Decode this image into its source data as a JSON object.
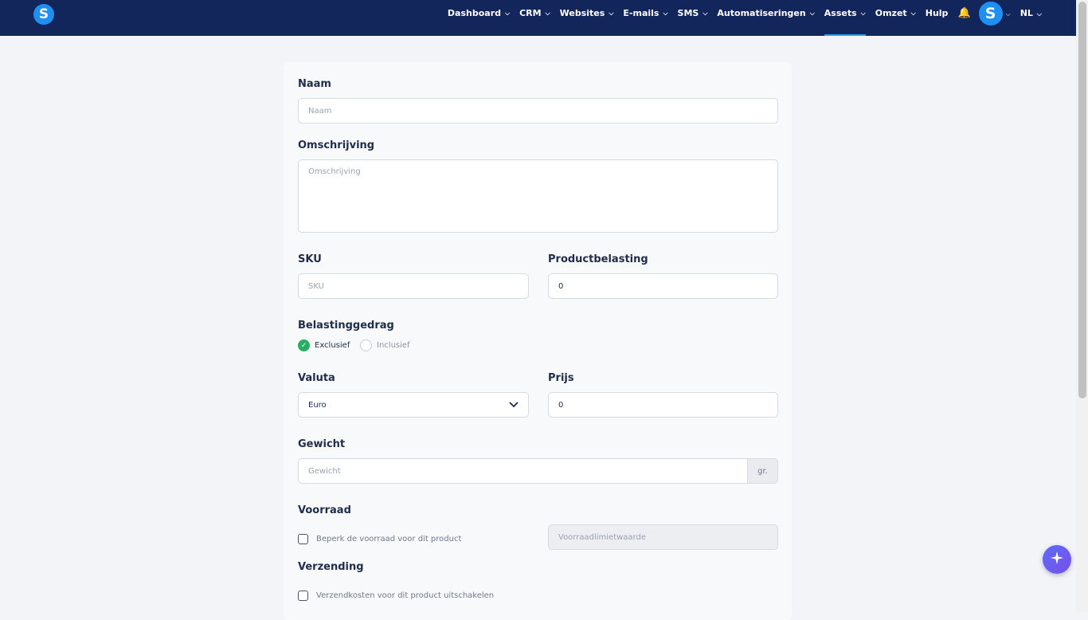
{
  "nav": {
    "logo_letter": "S",
    "items": [
      {
        "label": "Dashboard",
        "has_dropdown": true
      },
      {
        "label": "CRM",
        "has_dropdown": true
      },
      {
        "label": "Websites",
        "has_dropdown": true
      },
      {
        "label": "E-mails",
        "has_dropdown": true
      },
      {
        "label": "SMS",
        "has_dropdown": true
      },
      {
        "label": "Automatiseringen",
        "has_dropdown": true
      },
      {
        "label": "Assets",
        "has_dropdown": true,
        "active": true
      },
      {
        "label": "Omzet",
        "has_dropdown": true
      },
      {
        "label": "Hulp",
        "has_dropdown": false
      }
    ],
    "bell_icon": "bell-icon",
    "avatar_letter": "S",
    "language": "NL"
  },
  "form": {
    "name": {
      "label": "Naam",
      "placeholder": "Naam",
      "value": ""
    },
    "description": {
      "label": "Omschrijving",
      "placeholder": "Omschrijving",
      "value": ""
    },
    "sku": {
      "label": "SKU",
      "placeholder": "SKU",
      "value": ""
    },
    "product_tax": {
      "label": "Productbelasting",
      "value": "0"
    },
    "tax_behavior": {
      "label": "Belastinggedrag",
      "options": [
        {
          "label": "Exclusief",
          "selected": true
        },
        {
          "label": "Inclusief",
          "selected": false
        }
      ]
    },
    "currency": {
      "label": "Valuta",
      "value": "Euro"
    },
    "price": {
      "label": "Prijs",
      "value": "0"
    },
    "weight": {
      "label": "Gewicht",
      "placeholder": "Gewicht",
      "unit": "gr.",
      "value": ""
    },
    "stock": {
      "label": "Voorraad",
      "checkbox_label": "Beperk de voorraad voor dit product",
      "checked": false,
      "limit_placeholder": "Voorraadlimietwaarde"
    },
    "shipping": {
      "label": "Verzending",
      "checkbox_label": "Verzendkosten voor dit product uitschakelen",
      "checked": false
    }
  },
  "colors": {
    "nav_bg": "#13265c",
    "accent": "#1e90f3",
    "success": "#27ae60",
    "fab_gradient_start": "#5b6cf7",
    "fab_gradient_end": "#7b4ee8"
  },
  "fab": {
    "icon": "sparkle-icon"
  }
}
